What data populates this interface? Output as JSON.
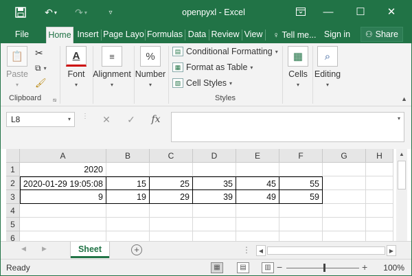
{
  "titlebar": {
    "title": "openpyxl - Excel",
    "save_icon": "save-icon",
    "undo_icon": "undo-icon",
    "redo_icon": "redo-icon",
    "qat_icon": "customize-qat-icon"
  },
  "tabs": [
    {
      "label": "File"
    },
    {
      "label": "Home"
    },
    {
      "label": "Insert"
    },
    {
      "label": "Page Layo"
    },
    {
      "label": "Formulas"
    },
    {
      "label": "Data"
    },
    {
      "label": "Review"
    },
    {
      "label": "View"
    },
    {
      "label": "Tell me..."
    }
  ],
  "signin": "Sign in",
  "share": "Share",
  "ribbon": {
    "paste": "Paste",
    "clipboard": "Clipboard",
    "font": "Font",
    "alignment": "Alignment",
    "number": "Number",
    "conditional_formatting": "Conditional Formatting",
    "format_as_table": "Format as Table",
    "cell_styles": "Cell Styles",
    "styles": "Styles",
    "cells": "Cells",
    "editing": "Editing"
  },
  "formula_bar": {
    "name_box": "L8",
    "formula": ""
  },
  "grid": {
    "columns": [
      "A",
      "B",
      "C",
      "D",
      "E",
      "F",
      "G",
      "H"
    ],
    "rows": [
      "1",
      "2",
      "3",
      "4",
      "5",
      "6"
    ],
    "cells": [
      [
        "2020",
        "",
        "",
        "",
        "",
        "",
        "",
        ""
      ],
      [
        "2020-01-29 19:05:08",
        "15",
        "25",
        "35",
        "45",
        "55",
        "",
        ""
      ],
      [
        "9",
        "19",
        "29",
        "39",
        "49",
        "59",
        "",
        ""
      ],
      [
        "",
        "",
        "",
        "",
        "",
        "",
        "",
        ""
      ],
      [
        "",
        "",
        "",
        "",
        "",
        "",
        "",
        ""
      ],
      [
        "",
        "",
        "",
        "",
        "",
        "",
        "",
        ""
      ]
    ]
  },
  "sheet_tab": "Sheet",
  "status": {
    "ready": "Ready",
    "zoom": "100%"
  },
  "colors": {
    "accent": "#217346"
  }
}
